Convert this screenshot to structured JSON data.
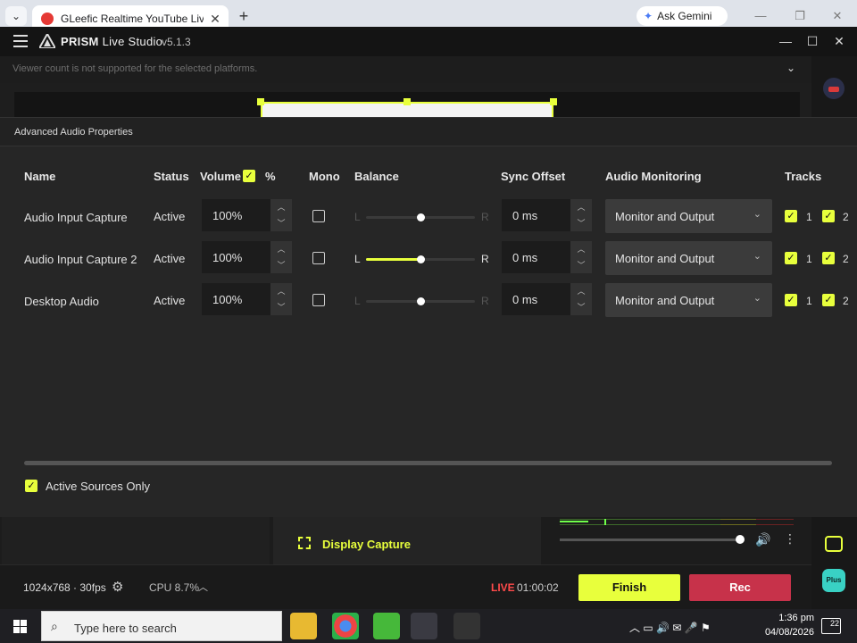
{
  "browser": {
    "tab_title": "GLeefic Realtime YouTube Live",
    "tab_close": "✕",
    "new_tab": "+",
    "ask_gemini": "Ask Gemini"
  },
  "app": {
    "name": "PRISM",
    "name_suffix": "Live Studio",
    "version": "v5.1.3",
    "viewer_note": "Viewer count is not supported for the selected platforms."
  },
  "dialog": {
    "title": "Advanced Audio Properties",
    "columns": {
      "name": "Name",
      "status": "Status",
      "volume": "Volume",
      "volume_unit": "%",
      "mono": "Mono",
      "balance": "Balance",
      "sync": "Sync Offset",
      "monitoring": "Audio Monitoring",
      "tracks": "Tracks"
    },
    "rows": [
      {
        "name": "Audio Input Capture",
        "status": "Active",
        "volume": "100%",
        "balance_l": "L",
        "balance_r": "R",
        "balance_level": 0.5,
        "sync": "0 ms",
        "monitoring": "Monitor and Output",
        "track1": "1",
        "track2": "2"
      },
      {
        "name": "Audio Input Capture 2",
        "status": "Active",
        "volume": "100%",
        "balance_l": "L",
        "balance_r": "R",
        "balance_level": 0.5,
        "sync": "0 ms",
        "monitoring": "Monitor and Output",
        "track1": "1",
        "track2": "2"
      },
      {
        "name": "Desktop Audio",
        "status": "Active",
        "volume": "100%",
        "balance_l": "L",
        "balance_r": "R",
        "balance_level": 0.5,
        "sync": "0 ms",
        "monitoring": "Monitor and Output",
        "track1": "1",
        "track2": "2"
      }
    ],
    "active_sources_only": "Active Sources Only"
  },
  "lower": {
    "display_capture": "Display Capture"
  },
  "status": {
    "resolution": "1024x768 · 30fps",
    "cpu": "CPU 8.7%",
    "live": "LIVE",
    "live_time": "01:00:02",
    "finish": "Finish",
    "rec": "Rec",
    "plus_badge": "Plus"
  },
  "taskbar": {
    "search_placeholder": "Type here to search",
    "time": "1:36 pm",
    "date": "04/08/2026",
    "notifications": "22"
  },
  "colors": {
    "accent": "#e8ff3c",
    "rec": "#c7324a",
    "live": "#ff4a4a"
  }
}
